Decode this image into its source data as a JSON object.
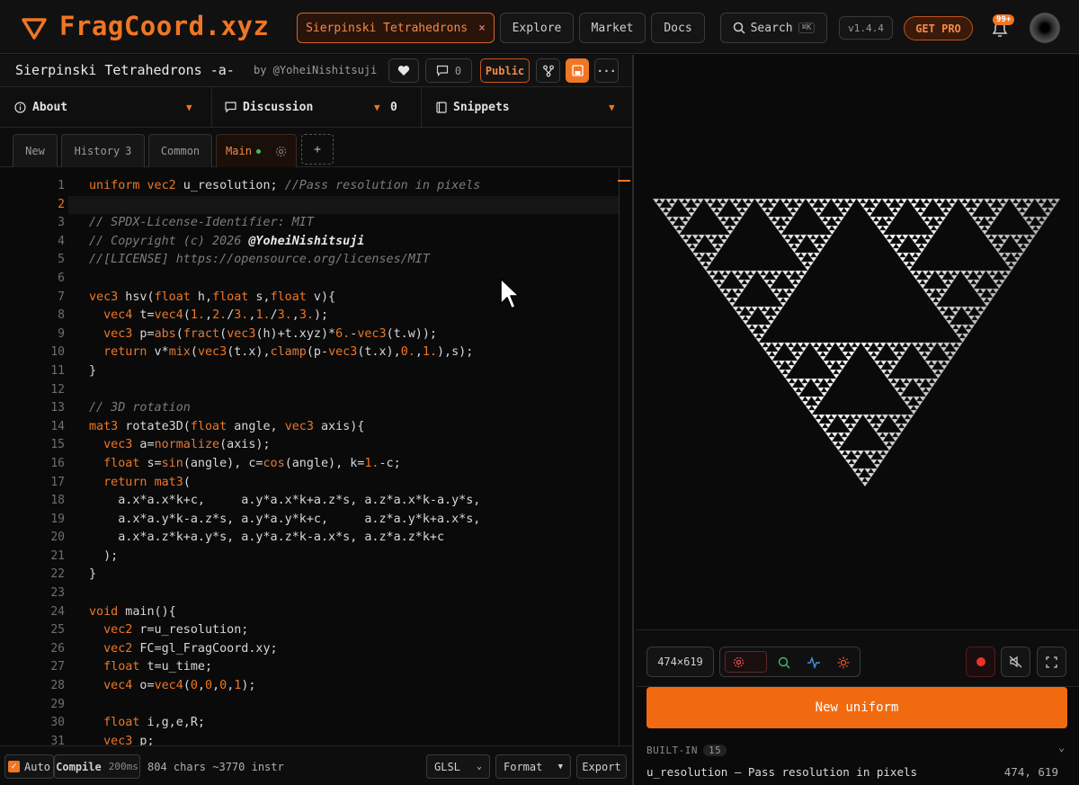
{
  "app": {
    "name": "FragCoord.xyz"
  },
  "topnav": {
    "current_shader_tab": "Sierpinski Tetrahedrons",
    "explore": "Explore",
    "market": "Market",
    "docs": "Docs",
    "search": "Search",
    "search_kbd": "⌘K",
    "version": "v1.4.4",
    "get_pro": "GET PRO",
    "notif_count": "99+"
  },
  "shader": {
    "title": "Sierpinski Tetrahedrons -a-",
    "author": "by @YoheiNishitsuji",
    "comment_count": "0",
    "visibility": "Public"
  },
  "sections": {
    "about": "About",
    "discussion": "Discussion",
    "discussion_count": "0",
    "snippets": "Snippets"
  },
  "tabs": {
    "new": "New",
    "history": "History",
    "history_count": "3",
    "common": "Common",
    "main": "Main",
    "add": "+"
  },
  "editor": {
    "line_numbers": [
      "1",
      "2",
      "3",
      "4",
      "5",
      "6",
      "7",
      "8",
      "9",
      "10",
      "11",
      "12",
      "13",
      "14",
      "15",
      "16",
      "17",
      "18",
      "19",
      "20",
      "21",
      "22",
      "23",
      "24",
      "25",
      "26",
      "27",
      "28",
      "29",
      "30",
      "31"
    ],
    "current_line": 2
  },
  "statusbar": {
    "auto": "Auto",
    "compile": "Compile",
    "compile_time": "200ms",
    "stats": "804 chars ~3770 instr",
    "language": "GLSL",
    "format": "Format",
    "export": "Export"
  },
  "preview": {
    "resolution": "474×619",
    "new_uniform": "New uniform",
    "builtin_label": "BUILT-IN",
    "builtin_count": "15",
    "uniform_name": "u_resolution",
    "uniform_desc": "u_resolution — Pass resolution in pixels",
    "uniform_value": "474, 619"
  },
  "colors": {
    "accent": "#f07623",
    "background": "#0a0a0a"
  }
}
